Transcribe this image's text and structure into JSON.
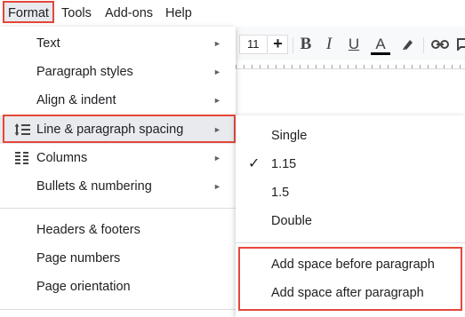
{
  "menubar": {
    "items": [
      "Format",
      "Tools",
      "Add-ons",
      "Help"
    ]
  },
  "toolbar": {
    "font_size": "11",
    "plus": "+",
    "bold": "B",
    "italic": "I",
    "underline": "U",
    "text_color": "A",
    "highlight": "✎",
    "link": "🔗",
    "comment": "▢"
  },
  "format_menu": {
    "items": [
      {
        "label": "Text",
        "has_submenu": true
      },
      {
        "label": "Paragraph styles",
        "has_submenu": true
      },
      {
        "label": "Align & indent",
        "has_submenu": true
      },
      {
        "label": "Line & paragraph spacing",
        "has_submenu": true,
        "icon": "line-spacing-icon",
        "selected": true
      },
      {
        "label": "Columns",
        "has_submenu": true,
        "icon": "columns-icon"
      },
      {
        "label": "Bullets & numbering",
        "has_submenu": true
      },
      {
        "label": "Headers & footers",
        "has_submenu": false
      },
      {
        "label": "Page numbers",
        "has_submenu": false
      },
      {
        "label": "Page orientation",
        "has_submenu": false
      }
    ],
    "arrow": "►"
  },
  "spacing_submenu": {
    "items": [
      {
        "label": "Single",
        "checked": false
      },
      {
        "label": "1.15",
        "checked": true
      },
      {
        "label": "1.5",
        "checked": false
      },
      {
        "label": "Double",
        "checked": false
      },
      {
        "label": "Add space before paragraph",
        "checked": false
      },
      {
        "label": "Add space after paragraph",
        "checked": false
      }
    ],
    "check": "✓"
  },
  "colors": {
    "highlight_border": "#e5473a",
    "hover_bg": "#e8eaed",
    "text": "#202124"
  }
}
